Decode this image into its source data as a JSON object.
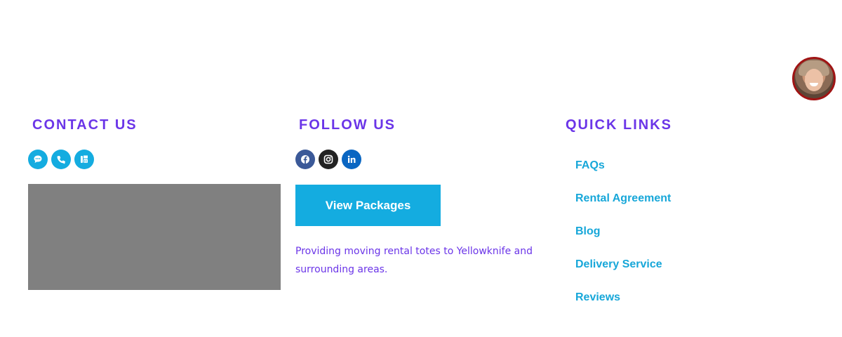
{
  "contact": {
    "title": "CONTACT US",
    "icons": [
      "chat-icon",
      "phone-icon",
      "fax-icon"
    ],
    "icon_color": "#14ace0"
  },
  "follow": {
    "title": "FOLLOW US",
    "icons": [
      {
        "name": "facebook-icon",
        "color": "#3b5998"
      },
      {
        "name": "instagram-icon",
        "color": "#222222"
      },
      {
        "name": "linkedin-icon",
        "color": "#0a66c2"
      }
    ],
    "button_label": "View Packages",
    "tagline": "Providing moving rental totes to Yellowknife and surrounding areas."
  },
  "quick_links": {
    "title": "QUICK LINKS",
    "items": [
      "FAQs",
      "Rental Agreement",
      "Blog",
      "Delivery Service",
      "Reviews"
    ]
  },
  "colors": {
    "heading": "#6b35e8",
    "accent": "#14ace0",
    "link": "#17a7d9",
    "map_placeholder": "#808080"
  }
}
